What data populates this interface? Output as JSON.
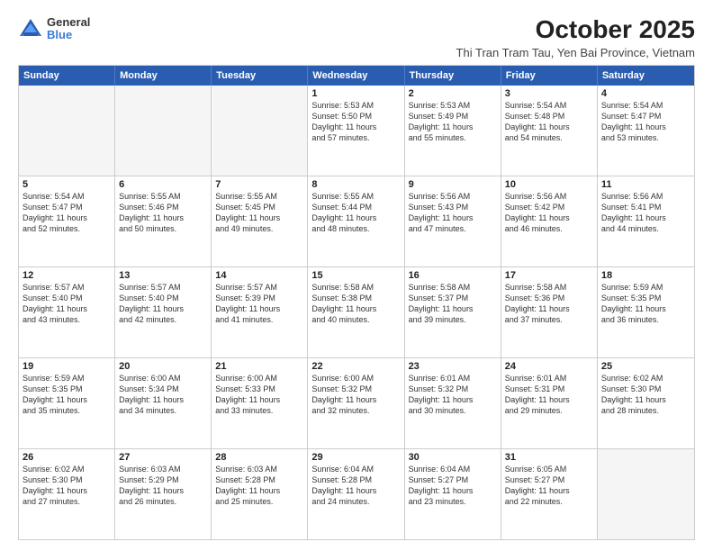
{
  "logo": {
    "general": "General",
    "blue": "Blue"
  },
  "title": "October 2025",
  "location": "Thi Tran Tram Tau, Yen Bai Province, Vietnam",
  "headers": [
    "Sunday",
    "Monday",
    "Tuesday",
    "Wednesday",
    "Thursday",
    "Friday",
    "Saturday"
  ],
  "weeks": [
    [
      {
        "day": "",
        "info": "",
        "empty": true
      },
      {
        "day": "",
        "info": "",
        "empty": true
      },
      {
        "day": "",
        "info": "",
        "empty": true
      },
      {
        "day": "1",
        "info": "Sunrise: 5:53 AM\nSunset: 5:50 PM\nDaylight: 11 hours\nand 57 minutes.",
        "empty": false
      },
      {
        "day": "2",
        "info": "Sunrise: 5:53 AM\nSunset: 5:49 PM\nDaylight: 11 hours\nand 55 minutes.",
        "empty": false
      },
      {
        "day": "3",
        "info": "Sunrise: 5:54 AM\nSunset: 5:48 PM\nDaylight: 11 hours\nand 54 minutes.",
        "empty": false
      },
      {
        "day": "4",
        "info": "Sunrise: 5:54 AM\nSunset: 5:47 PM\nDaylight: 11 hours\nand 53 minutes.",
        "empty": false
      }
    ],
    [
      {
        "day": "5",
        "info": "Sunrise: 5:54 AM\nSunset: 5:47 PM\nDaylight: 11 hours\nand 52 minutes.",
        "empty": false
      },
      {
        "day": "6",
        "info": "Sunrise: 5:55 AM\nSunset: 5:46 PM\nDaylight: 11 hours\nand 50 minutes.",
        "empty": false
      },
      {
        "day": "7",
        "info": "Sunrise: 5:55 AM\nSunset: 5:45 PM\nDaylight: 11 hours\nand 49 minutes.",
        "empty": false
      },
      {
        "day": "8",
        "info": "Sunrise: 5:55 AM\nSunset: 5:44 PM\nDaylight: 11 hours\nand 48 minutes.",
        "empty": false
      },
      {
        "day": "9",
        "info": "Sunrise: 5:56 AM\nSunset: 5:43 PM\nDaylight: 11 hours\nand 47 minutes.",
        "empty": false
      },
      {
        "day": "10",
        "info": "Sunrise: 5:56 AM\nSunset: 5:42 PM\nDaylight: 11 hours\nand 46 minutes.",
        "empty": false
      },
      {
        "day": "11",
        "info": "Sunrise: 5:56 AM\nSunset: 5:41 PM\nDaylight: 11 hours\nand 44 minutes.",
        "empty": false
      }
    ],
    [
      {
        "day": "12",
        "info": "Sunrise: 5:57 AM\nSunset: 5:40 PM\nDaylight: 11 hours\nand 43 minutes.",
        "empty": false
      },
      {
        "day": "13",
        "info": "Sunrise: 5:57 AM\nSunset: 5:40 PM\nDaylight: 11 hours\nand 42 minutes.",
        "empty": false
      },
      {
        "day": "14",
        "info": "Sunrise: 5:57 AM\nSunset: 5:39 PM\nDaylight: 11 hours\nand 41 minutes.",
        "empty": false
      },
      {
        "day": "15",
        "info": "Sunrise: 5:58 AM\nSunset: 5:38 PM\nDaylight: 11 hours\nand 40 minutes.",
        "empty": false
      },
      {
        "day": "16",
        "info": "Sunrise: 5:58 AM\nSunset: 5:37 PM\nDaylight: 11 hours\nand 39 minutes.",
        "empty": false
      },
      {
        "day": "17",
        "info": "Sunrise: 5:58 AM\nSunset: 5:36 PM\nDaylight: 11 hours\nand 37 minutes.",
        "empty": false
      },
      {
        "day": "18",
        "info": "Sunrise: 5:59 AM\nSunset: 5:35 PM\nDaylight: 11 hours\nand 36 minutes.",
        "empty": false
      }
    ],
    [
      {
        "day": "19",
        "info": "Sunrise: 5:59 AM\nSunset: 5:35 PM\nDaylight: 11 hours\nand 35 minutes.",
        "empty": false
      },
      {
        "day": "20",
        "info": "Sunrise: 6:00 AM\nSunset: 5:34 PM\nDaylight: 11 hours\nand 34 minutes.",
        "empty": false
      },
      {
        "day": "21",
        "info": "Sunrise: 6:00 AM\nSunset: 5:33 PM\nDaylight: 11 hours\nand 33 minutes.",
        "empty": false
      },
      {
        "day": "22",
        "info": "Sunrise: 6:00 AM\nSunset: 5:32 PM\nDaylight: 11 hours\nand 32 minutes.",
        "empty": false
      },
      {
        "day": "23",
        "info": "Sunrise: 6:01 AM\nSunset: 5:32 PM\nDaylight: 11 hours\nand 30 minutes.",
        "empty": false
      },
      {
        "day": "24",
        "info": "Sunrise: 6:01 AM\nSunset: 5:31 PM\nDaylight: 11 hours\nand 29 minutes.",
        "empty": false
      },
      {
        "day": "25",
        "info": "Sunrise: 6:02 AM\nSunset: 5:30 PM\nDaylight: 11 hours\nand 28 minutes.",
        "empty": false
      }
    ],
    [
      {
        "day": "26",
        "info": "Sunrise: 6:02 AM\nSunset: 5:30 PM\nDaylight: 11 hours\nand 27 minutes.",
        "empty": false
      },
      {
        "day": "27",
        "info": "Sunrise: 6:03 AM\nSunset: 5:29 PM\nDaylight: 11 hours\nand 26 minutes.",
        "empty": false
      },
      {
        "day": "28",
        "info": "Sunrise: 6:03 AM\nSunset: 5:28 PM\nDaylight: 11 hours\nand 25 minutes.",
        "empty": false
      },
      {
        "day": "29",
        "info": "Sunrise: 6:04 AM\nSunset: 5:28 PM\nDaylight: 11 hours\nand 24 minutes.",
        "empty": false
      },
      {
        "day": "30",
        "info": "Sunrise: 6:04 AM\nSunset: 5:27 PM\nDaylight: 11 hours\nand 23 minutes.",
        "empty": false
      },
      {
        "day": "31",
        "info": "Sunrise: 6:05 AM\nSunset: 5:27 PM\nDaylight: 11 hours\nand 22 minutes.",
        "empty": false
      },
      {
        "day": "",
        "info": "",
        "empty": true
      }
    ]
  ]
}
